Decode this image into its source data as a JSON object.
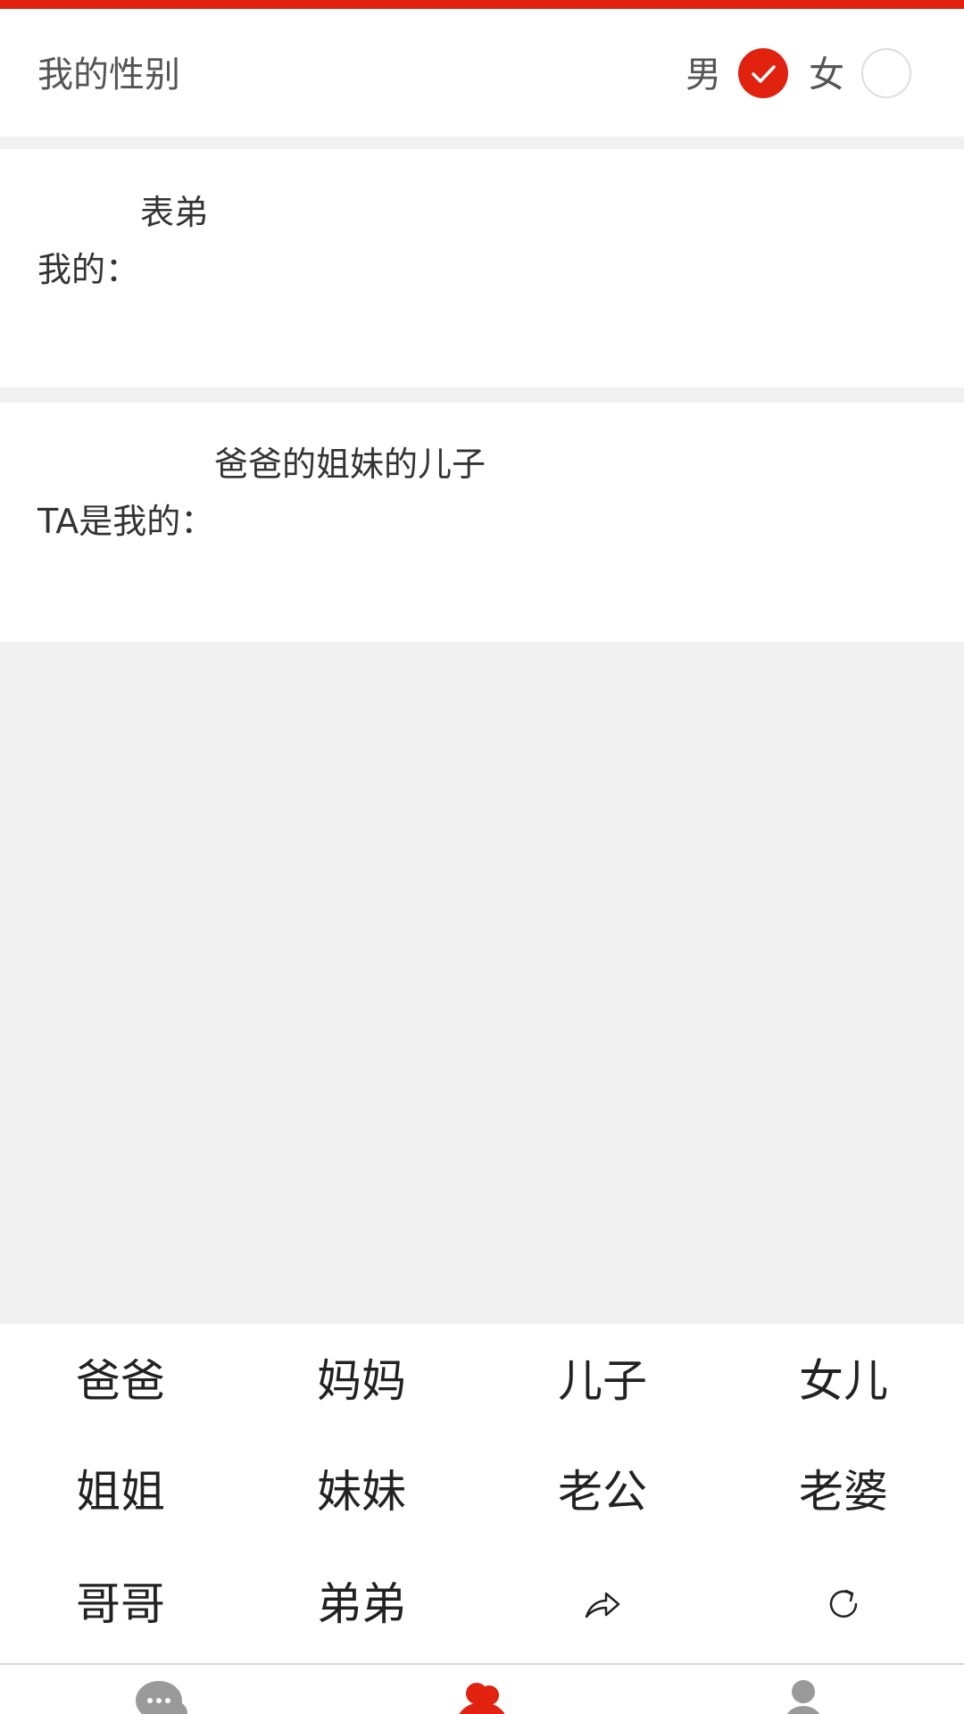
{
  "gender": {
    "title": "我的性别",
    "male_label": "男",
    "female_label": "女",
    "selected": "male"
  },
  "my_relation": {
    "label": "我的：",
    "value": "表弟"
  },
  "ta_relation": {
    "label": "TA是我的：",
    "value": "爸爸的姐妹的儿子"
  },
  "keyboard": {
    "keys": [
      [
        "爸爸",
        "妈妈",
        "儿子",
        "女儿"
      ],
      [
        "姐姐",
        "妹妹",
        "老公",
        "老婆"
      ],
      [
        "哥哥",
        "弟弟"
      ]
    ],
    "icons": [
      "share-arrow-icon",
      "refresh-icon"
    ]
  },
  "tabbar": {
    "tabs": [
      {
        "icon": "chat-icon",
        "active": false
      },
      {
        "icon": "relatives-icon",
        "active": true
      },
      {
        "icon": "profile-icon",
        "active": false
      }
    ]
  },
  "colors": {
    "accent": "#e0220f",
    "background": "#f0f0f0",
    "text": "#333333",
    "inactive_icon": "#9a9a9a"
  }
}
